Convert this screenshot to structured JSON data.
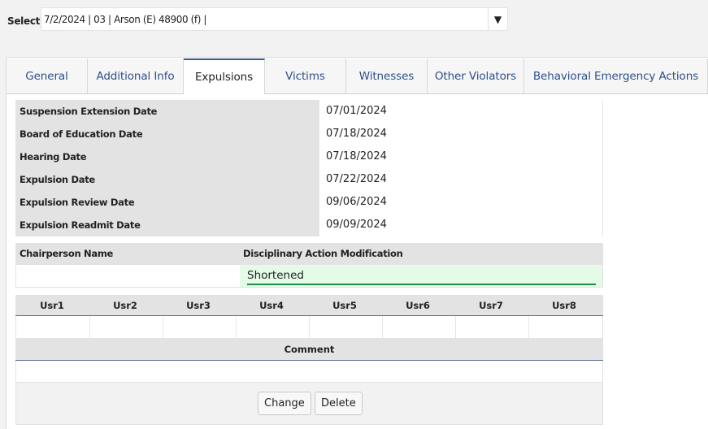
{
  "selector": {
    "label": "Select:",
    "value": "7/2/2024 | 03 | Arson (E) 48900 (f) |"
  },
  "tabs": [
    {
      "label": "General"
    },
    {
      "label": "Additional Info"
    },
    {
      "label": "Expulsions",
      "active": true
    },
    {
      "label": "Victims"
    },
    {
      "label": "Witnesses"
    },
    {
      "label": "Other Violators"
    },
    {
      "label": "Behavioral Emergency Actions"
    }
  ],
  "dates": [
    {
      "label": "Suspension Extension Date",
      "value": "07/01/2024"
    },
    {
      "label": "Board of Education Date",
      "value": "07/18/2024"
    },
    {
      "label": "Hearing Date",
      "value": "07/18/2024"
    },
    {
      "label": "Expulsion Date",
      "value": "07/22/2024"
    },
    {
      "label": "Expulsion Review Date",
      "value": "09/06/2024"
    },
    {
      "label": "Expulsion Readmit Date",
      "value": "09/09/2024"
    }
  ],
  "chairperson": {
    "label": "Chairperson Name",
    "value": ""
  },
  "modification": {
    "label": "Disciplinary Action Modification",
    "value": "Shortened"
  },
  "user_fields": {
    "headers": [
      "Usr1",
      "Usr2",
      "Usr3",
      "Usr4",
      "Usr5",
      "Usr6",
      "Usr7",
      "Usr8"
    ],
    "values": [
      "",
      "",
      "",
      "",
      "",
      "",
      "",
      ""
    ]
  },
  "comment": {
    "label": "Comment",
    "value": ""
  },
  "actions": {
    "change_label": "Change",
    "delete_label": "Delete"
  },
  "colors": {
    "tab_text": "#2d4f8a",
    "active_tab_border": "#3a5a8c",
    "modified_field_bg": "#e4fbe7",
    "modified_field_underline": "#1f8a4c",
    "label_bg": "#e3e3e3"
  }
}
